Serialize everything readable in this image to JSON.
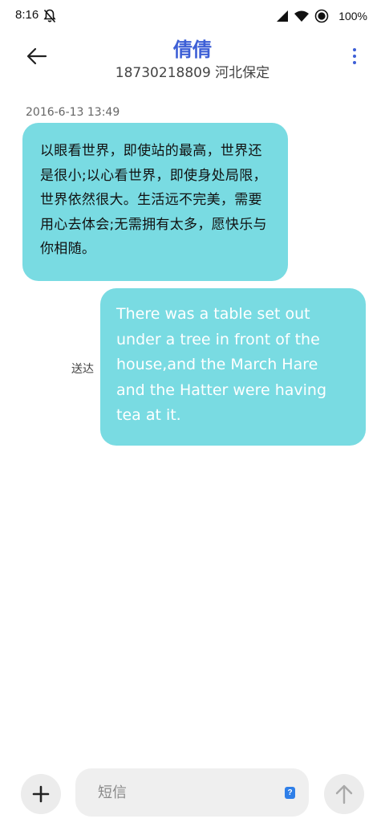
{
  "status_bar": {
    "time": "8:16",
    "battery": "100%",
    "icons": [
      "bell-muted-icon",
      "cellular-signal-icon",
      "wifi-icon",
      "dnd-icon"
    ]
  },
  "header": {
    "contact_name": "倩倩",
    "contact_sub": "18730218809 河北保定",
    "back_icon": "arrow-left-icon",
    "more_icon": "more-vertical-icon",
    "accent_color": "#3d5fd6"
  },
  "conversation": {
    "timestamp": "2016-6-13 13:49",
    "received_message": "以眼看世界，即使站的最高，世界还是很小;以心看世界，即使身处局限，世界依然很大。生活远不完美，需要用心去体会;无需拥有太多，愿快乐与你相随。",
    "sent_message": "There was a table set out under a tree in front of the house,and the March Hare and the Hatter were having tea at it.",
    "sent_status": "送达",
    "bubble_color": "#79dbe2"
  },
  "compose": {
    "placeholder": "短信",
    "sim_label": "?",
    "add_icon": "plus-icon",
    "send_icon": "arrow-up-icon"
  }
}
